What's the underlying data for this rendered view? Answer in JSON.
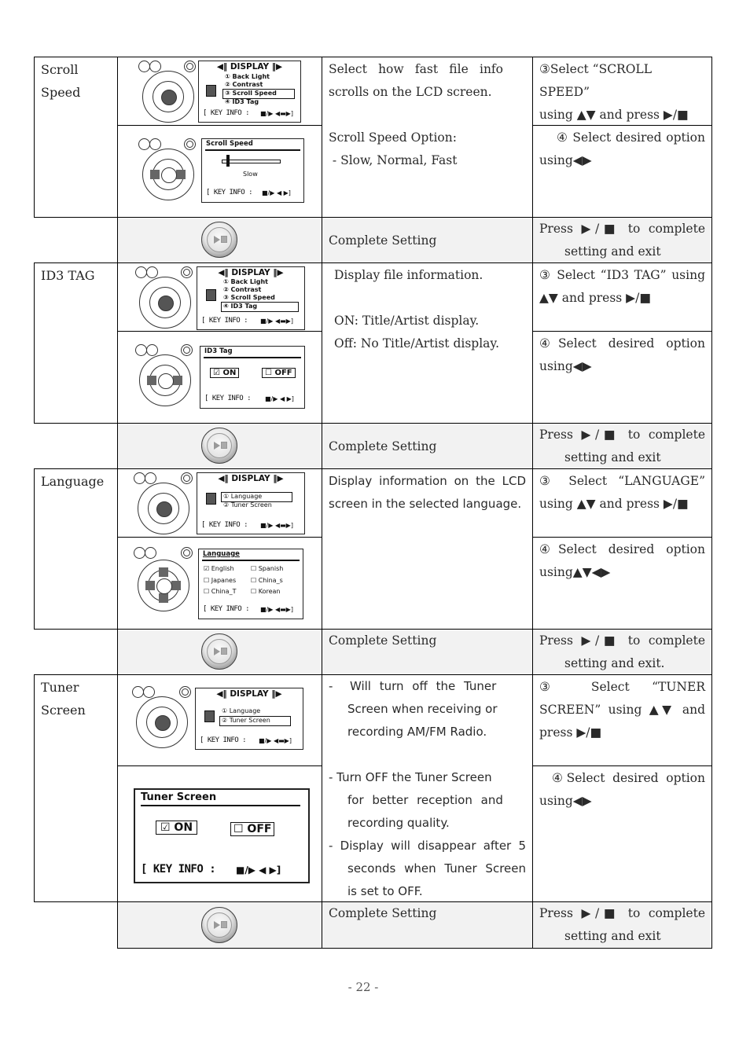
{
  "page": {
    "number": "- 22 -"
  },
  "sections": [
    {
      "name": "Scroll Speed",
      "label_lines": [
        "Scroll",
        "Speed"
      ],
      "description": [
        "Select how fast file info",
        "scrolls on the LCD screen.",
        "",
        "Scroll Speed Option:",
        " - Slow, Normal, Fast"
      ],
      "step3": [
        "③Select “SCROLL SPEED”",
        "using ▲▼ and press ▶/■"
      ],
      "step4": [
        "④ Select desired option",
        "using◀▶"
      ],
      "lcd1": {
        "header": "◀‖ DISPLAY ‖▶",
        "items": [
          "① Back Light",
          "② Contrast",
          "③ Scroll Speed",
          "④ ID3 Tag"
        ],
        "selected_index": 2,
        "keyinfo": "[ KEY INFO :",
        "keys": "■/▶ ◀▬▶]"
      },
      "lcd2": {
        "title": "Scroll Speed",
        "slider_value": "Slow",
        "slider_level": 0.0,
        "keyinfo": "[ KEY INFO :",
        "keys": "■/▶ ◀ ▶]"
      },
      "complete": {
        "label": "Complete Setting",
        "instr": [
          "Press ▶/■ to complete",
          "setting and exit"
        ]
      }
    },
    {
      "name": "ID3 TAG",
      "label_lines": [
        "ID3 TAG"
      ],
      "description": [
        "Display file information.",
        "",
        "ON: Title/Artist display.",
        "Off: No Title/Artist display."
      ],
      "step3": [
        "③ Select “ID3 TAG” using",
        "▲▼ and press ▶/■"
      ],
      "step4": [
        "④Select desired option",
        "using◀▶"
      ],
      "lcd1": {
        "header": "◀‖ DISPLAY ‖▶",
        "items": [
          "① Back Light",
          "② Contrast",
          "③ Scroll Speed",
          "④ ID3 Tag"
        ],
        "selected_index": 3,
        "keyinfo": "[ KEY INFO :",
        "keys": "■/▶ ◀▬▶]"
      },
      "lcd2": {
        "title": "ID3 Tag",
        "on_label": "☑ ON",
        "off_label": "☐ OFF",
        "keyinfo": "[ KEY INFO :",
        "keys": "■/▶ ◀ ▶]"
      },
      "complete": {
        "label": "Complete Setting",
        "instr": [
          "Press ▶/■ to complete",
          "setting and exit"
        ]
      }
    },
    {
      "name": "Language",
      "label_lines": [
        "Language"
      ],
      "description": [
        "Display information on the LCD",
        "screen in the selected language."
      ],
      "step3": [
        "③ Select “LANGUAGE”",
        "using ▲▼ and press ▶/■"
      ],
      "step4": [
        "④Select desired option",
        "using▲▼◀▶"
      ],
      "lcd1": {
        "header": "◀‖ DISPLAY ‖▶",
        "items": [
          "① Language",
          "② Tuner Screen"
        ],
        "selected_index": 0,
        "keyinfo": "[ KEY INFO :",
        "keys": "■/▶ ◀▬▶]"
      },
      "lcd2": {
        "title": "Language",
        "options": [
          "☑ English",
          "☐ Spanish",
          "☐ Japanes",
          "☐ China_s",
          "☐ China_T",
          "☐ Korean"
        ],
        "keyinfo": "[ KEY INFO :",
        "keys": "■/▶ ◀▬▶]"
      },
      "complete": {
        "label": "Complete Setting",
        "instr": [
          "Press ▶/■ to complete",
          "setting and exit."
        ]
      }
    },
    {
      "name": "Tuner Screen",
      "label_lines": [
        "Tuner",
        "Screen"
      ],
      "description": [
        "-  Will turn off the Tuner",
        "Screen when receiving or",
        "recording AM/FM Radio.",
        "",
        "- Turn OFF the Tuner Screen",
        "for better reception and",
        "recording quality.",
        "-  Display will disappear after 5",
        "seconds when Tuner Screen",
        "is set to OFF."
      ],
      "step3": [
        "③ Select “TUNER",
        "SCREEN” using ▲▼ and",
        "press ▶/■"
      ],
      "step4": [
        "④Select desired option",
        "using◀▶"
      ],
      "lcd1": {
        "header": "◀‖ DISPLAY ‖▶",
        "items": [
          "① Language",
          "② Tuner Screen"
        ],
        "selected_index": 1,
        "keyinfo": "[ KEY INFO :",
        "keys": "■/▶ ◀▬▶]"
      },
      "lcd2": {
        "title": "Tuner Screen",
        "on_label": "☑ ON",
        "off_label": "☐ OFF",
        "keyinfo": "[ KEY INFO :",
        "keys": "■/▶ ◀ ▶]"
      },
      "complete": {
        "label": "Complete Setting",
        "instr": [
          "Press ▶/■ to complete",
          "setting and exit"
        ]
      }
    }
  ]
}
